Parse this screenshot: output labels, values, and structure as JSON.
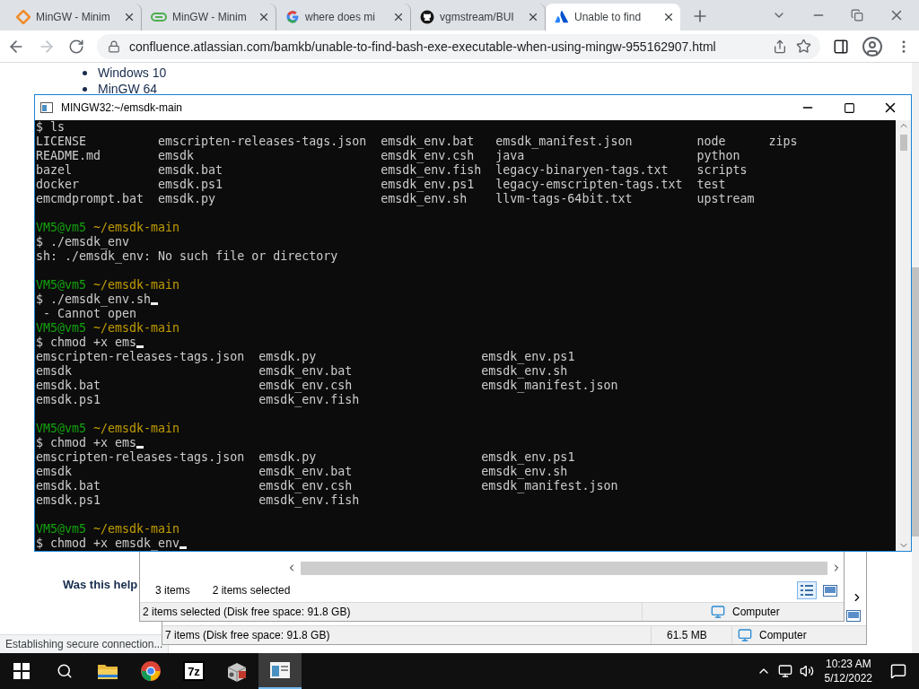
{
  "browser": {
    "tabs": [
      {
        "kind": "diamond",
        "title": "MinGW - Minim",
        "selected": false
      },
      {
        "kind": "chip",
        "title": "MinGW - Minim",
        "selected": false
      },
      {
        "kind": "google",
        "title": "where does mi",
        "selected": false
      },
      {
        "kind": "github",
        "title": "vgmstream/BUI",
        "selected": false
      },
      {
        "kind": "atlassian",
        "title": "Unable to find",
        "selected": true
      }
    ],
    "nav": [
      {
        "kind": "back",
        "disabled": false
      },
      {
        "kind": "forward",
        "disabled": true
      },
      {
        "kind": "reload",
        "disabled": false
      }
    ],
    "url": "confluence.atlassian.com/bamkb/unable-to-find-bash-exe-executable-when-using-mingw-955162907.html",
    "page": {
      "bullets": [
        "Windows 10",
        "MinGW 64"
      ],
      "feedback": "Was this help"
    },
    "status": "Establishing secure connection..."
  },
  "explorer_back": {
    "status": "7 items (Disk free space: 91.8 GB)",
    "size": "61.5 MB",
    "location": "Computer"
  },
  "explorer_front": {
    "item_count": "3 items",
    "selection": "2 items selected",
    "status": "2 items selected (Disk free space: 91.8 GB)",
    "location": "Computer",
    "views": [
      {
        "kind": "details",
        "selected": true
      },
      {
        "kind": "preview",
        "selected": false
      }
    ]
  },
  "terminal": {
    "title": "MINGW32:~/emsdk-main",
    "lines": [
      {
        "kind": "command",
        "text": "$ ls",
        "cursor": false
      },
      {
        "kind": "ls",
        "columns": [
          [
            "LICENSE",
            "README.md",
            "bazel",
            "docker",
            "emcmdprompt.bat"
          ],
          [
            "emscripten-releases-tags.json",
            "emsdk",
            "emsdk.bat",
            "emsdk.ps1",
            "emsdk.py"
          ],
          [
            "emsdk_env.bat",
            "emsdk_env.csh",
            "emsdk_env.fish",
            "emsdk_env.ps1",
            "emsdk_env.sh"
          ],
          [
            "emsdk_manifest.json",
            "java",
            "legacy-binaryen-tags.txt",
            "legacy-emscripten-tags.txt",
            "llvm-tags-64bit.txt"
          ],
          [
            "node",
            "python",
            "scripts",
            "test",
            "upstream"
          ],
          [
            "zips"
          ]
        ]
      },
      {
        "kind": "blank"
      },
      {
        "kind": "prompt",
        "user": "VM5@vm5",
        "path": "~/emsdk-main"
      },
      {
        "kind": "command",
        "text": "$ ./emsdk_env",
        "cursor": false
      },
      {
        "kind": "output",
        "text": "sh: ./emsdk_env: No such file or directory"
      },
      {
        "kind": "blank"
      },
      {
        "kind": "prompt",
        "user": "VM5@vm5",
        "path": "~/emsdk-main"
      },
      {
        "kind": "command",
        "text": "$ ./emsdk_env.sh",
        "cursor": true
      },
      {
        "kind": "output",
        "text": " - Cannot open"
      },
      {
        "kind": "prompt",
        "user": "VM5@vm5",
        "path": "~/emsdk-main"
      },
      {
        "kind": "command",
        "text": "$ chmod +x ems",
        "cursor": true
      },
      {
        "kind": "completion",
        "columns": [
          [
            "emscripten-releases-tags.json",
            "emsdk",
            "emsdk.bat",
            "emsdk.ps1"
          ],
          [
            "emsdk.py",
            "emsdk_env.bat",
            "emsdk_env.csh",
            "emsdk_env.fish"
          ],
          [
            "emsdk_env.ps1",
            "emsdk_env.sh",
            "emsdk_manifest.json"
          ]
        ]
      },
      {
        "kind": "blank"
      },
      {
        "kind": "prompt",
        "user": "VM5@vm5",
        "path": "~/emsdk-main"
      },
      {
        "kind": "command",
        "text": "$ chmod +x ems",
        "cursor": true
      },
      {
        "kind": "completion",
        "columns": [
          [
            "emscripten-releases-tags.json",
            "emsdk",
            "emsdk.bat",
            "emsdk.ps1"
          ],
          [
            "emsdk.py",
            "emsdk_env.bat",
            "emsdk_env.csh",
            "emsdk_env.fish"
          ],
          [
            "emsdk_env.ps1",
            "emsdk_env.sh",
            "emsdk_manifest.json"
          ]
        ]
      },
      {
        "kind": "blank"
      },
      {
        "kind": "prompt",
        "user": "VM5@vm5",
        "path": "~/emsdk-main"
      },
      {
        "kind": "command",
        "text": "$ chmod +x emsdk_env",
        "cursor": true
      }
    ]
  },
  "taskbar": {
    "apps": [
      {
        "kind": "explorer",
        "selected": false
      },
      {
        "kind": "chrome",
        "selected": false
      },
      {
        "kind": "archiver",
        "label": "7z",
        "selected": false
      },
      {
        "kind": "installer",
        "selected": false
      },
      {
        "kind": "terminal",
        "selected": true
      }
    ],
    "time": "10:23 AM",
    "date": "5/12/2022"
  }
}
